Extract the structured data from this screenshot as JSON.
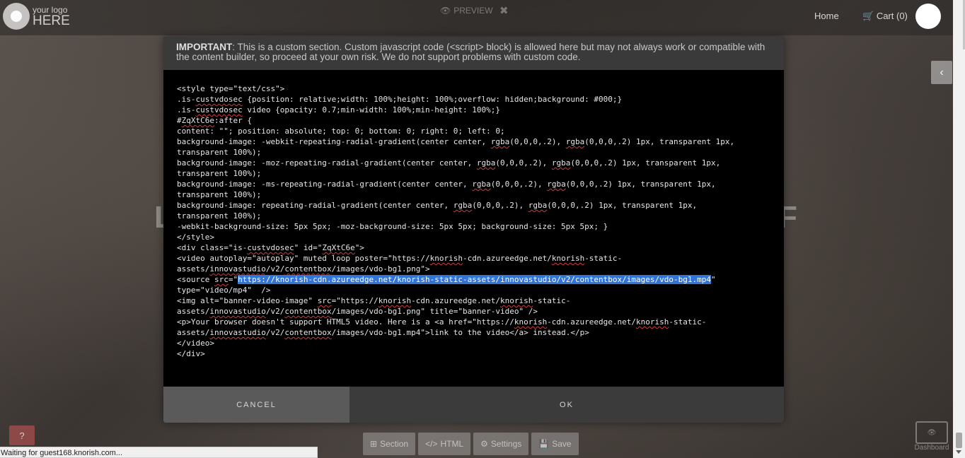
{
  "header": {
    "logo_line1": "your logo",
    "logo_line2": "HERE",
    "preview_label": "PREVIEW",
    "preview_close": "✖",
    "nav_home": "Home",
    "nav_cart": "Cart (0)"
  },
  "background": {
    "ghost_left": "L",
    "ghost_right": "F"
  },
  "toolbar": {
    "section": "Section",
    "html": "HTML",
    "settings": "Settings",
    "save": "Save"
  },
  "help_label": "?",
  "dashboard_label": "Dashboard",
  "status_text": "Waiting for guest168.knorish.com...",
  "modal": {
    "notice_bold": "IMPORTANT",
    "notice_text": ": This is a custom section. Custom javascript code (<script> block) is allowed here but may not always work or compatible with the content builder, so proceed at your own risk. We do not support problems with custom code.",
    "code_lines": [
      "<style type=\"text/css\">",
      ".is-custvdosec {position: relative;width: 100%;height: 100%;overflow: hidden;background: #000;}",
      ".is-custvdosec video {opacity: 0.7;min-width: 100%;min-height: 100%;}",
      "#ZqXtC6e:after {",
      "content: \"\"; position: absolute; top: 0; bottom: 0; right: 0; left: 0;",
      "background-image: -webkit-repeating-radial-gradient(center center, rgba(0,0,0,.2), rgba(0,0,0,.2) 1px, transparent 1px,",
      "transparent 100%);",
      "background-image: -moz-repeating-radial-gradient(center center, rgba(0,0,0,.2), rgba(0,0,0,.2) 1px, transparent 1px,",
      "transparent 100%);",
      "background-image: -ms-repeating-radial-gradient(center center, rgba(0,0,0,.2), rgba(0,0,0,.2) 1px, transparent 1px,",
      "transparent 100%);",
      "background-image: repeating-radial-gradient(center center, rgba(0,0,0,.2), rgba(0,0,0,.2) 1px, transparent 1px,",
      "transparent 100%);",
      "-webkit-background-size: 5px 5px; -moz-background-size: 5px 5px; background-size: 5px 5px; }",
      "</style>",
      "<div class=\"is-custvdosec\" id=\"ZqXtC6e\">",
      "<video autoplay=\"autoplay\" muted loop poster=\"https://knorish-cdn.azureedge.net/knorish-static-",
      "assets/innovastudio/v2/contentbox/images/vdo-bg1.png\">",
      "<source src=\"",
      "type=\"video/mp4\"  />",
      "<img alt=\"banner-video-image\" src=\"https://knorish-cdn.azureedge.net/knorish-static-",
      "assets/innovastudio/v2/contentbox/images/vdo-bg1.png\" title=\"banner-video\" />",
      "<p>Your browser doesn't support HTML5 video. Here is a <a href=\"https://knorish-cdn.azureedge.net/knorish-static-",
      "assets/innovastudio/v2/contentbox/images/vdo-bg1.mp4\">link to the video</a> instead.</p>",
      "</video>",
      "</div>"
    ],
    "selected_url": "https://knorish-cdn.azureedge.net/knorish-static-assets/innovastudio/v2/contentbox/images/vdo-bg1.mp4",
    "selected_suffix": "\"",
    "cancel_label": "CANCEL",
    "ok_label": "OK"
  }
}
